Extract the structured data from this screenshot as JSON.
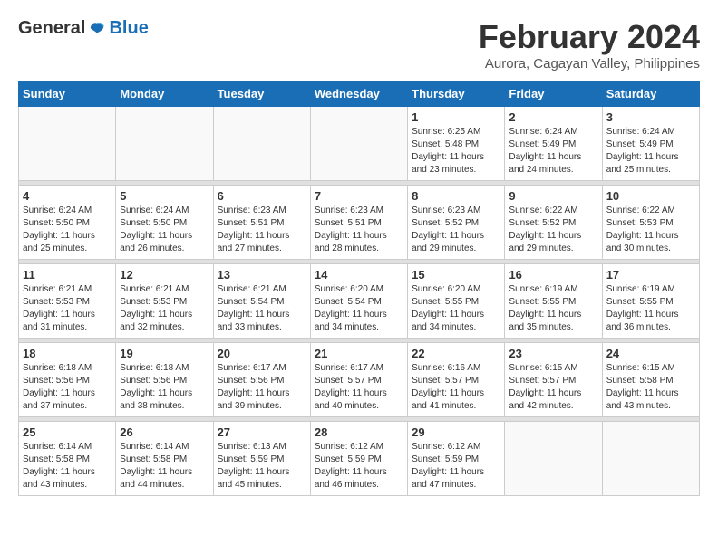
{
  "header": {
    "logo_general": "General",
    "logo_blue": "Blue",
    "title": "February 2024",
    "subtitle": "Aurora, Cagayan Valley, Philippines"
  },
  "weekdays": [
    "Sunday",
    "Monday",
    "Tuesday",
    "Wednesday",
    "Thursday",
    "Friday",
    "Saturday"
  ],
  "weeks": [
    [
      {
        "day": "",
        "sunrise": "",
        "sunset": "",
        "daylight": ""
      },
      {
        "day": "",
        "sunrise": "",
        "sunset": "",
        "daylight": ""
      },
      {
        "day": "",
        "sunrise": "",
        "sunset": "",
        "daylight": ""
      },
      {
        "day": "",
        "sunrise": "",
        "sunset": "",
        "daylight": ""
      },
      {
        "day": "1",
        "sunrise": "Sunrise: 6:25 AM",
        "sunset": "Sunset: 5:48 PM",
        "daylight": "Daylight: 11 hours and 23 minutes."
      },
      {
        "day": "2",
        "sunrise": "Sunrise: 6:24 AM",
        "sunset": "Sunset: 5:49 PM",
        "daylight": "Daylight: 11 hours and 24 minutes."
      },
      {
        "day": "3",
        "sunrise": "Sunrise: 6:24 AM",
        "sunset": "Sunset: 5:49 PM",
        "daylight": "Daylight: 11 hours and 25 minutes."
      }
    ],
    [
      {
        "day": "4",
        "sunrise": "Sunrise: 6:24 AM",
        "sunset": "Sunset: 5:50 PM",
        "daylight": "Daylight: 11 hours and 25 minutes."
      },
      {
        "day": "5",
        "sunrise": "Sunrise: 6:24 AM",
        "sunset": "Sunset: 5:50 PM",
        "daylight": "Daylight: 11 hours and 26 minutes."
      },
      {
        "day": "6",
        "sunrise": "Sunrise: 6:23 AM",
        "sunset": "Sunset: 5:51 PM",
        "daylight": "Daylight: 11 hours and 27 minutes."
      },
      {
        "day": "7",
        "sunrise": "Sunrise: 6:23 AM",
        "sunset": "Sunset: 5:51 PM",
        "daylight": "Daylight: 11 hours and 28 minutes."
      },
      {
        "day": "8",
        "sunrise": "Sunrise: 6:23 AM",
        "sunset": "Sunset: 5:52 PM",
        "daylight": "Daylight: 11 hours and 29 minutes."
      },
      {
        "day": "9",
        "sunrise": "Sunrise: 6:22 AM",
        "sunset": "Sunset: 5:52 PM",
        "daylight": "Daylight: 11 hours and 29 minutes."
      },
      {
        "day": "10",
        "sunrise": "Sunrise: 6:22 AM",
        "sunset": "Sunset: 5:53 PM",
        "daylight": "Daylight: 11 hours and 30 minutes."
      }
    ],
    [
      {
        "day": "11",
        "sunrise": "Sunrise: 6:21 AM",
        "sunset": "Sunset: 5:53 PM",
        "daylight": "Daylight: 11 hours and 31 minutes."
      },
      {
        "day": "12",
        "sunrise": "Sunrise: 6:21 AM",
        "sunset": "Sunset: 5:53 PM",
        "daylight": "Daylight: 11 hours and 32 minutes."
      },
      {
        "day": "13",
        "sunrise": "Sunrise: 6:21 AM",
        "sunset": "Sunset: 5:54 PM",
        "daylight": "Daylight: 11 hours and 33 minutes."
      },
      {
        "day": "14",
        "sunrise": "Sunrise: 6:20 AM",
        "sunset": "Sunset: 5:54 PM",
        "daylight": "Daylight: 11 hours and 34 minutes."
      },
      {
        "day": "15",
        "sunrise": "Sunrise: 6:20 AM",
        "sunset": "Sunset: 5:55 PM",
        "daylight": "Daylight: 11 hours and 34 minutes."
      },
      {
        "day": "16",
        "sunrise": "Sunrise: 6:19 AM",
        "sunset": "Sunset: 5:55 PM",
        "daylight": "Daylight: 11 hours and 35 minutes."
      },
      {
        "day": "17",
        "sunrise": "Sunrise: 6:19 AM",
        "sunset": "Sunset: 5:55 PM",
        "daylight": "Daylight: 11 hours and 36 minutes."
      }
    ],
    [
      {
        "day": "18",
        "sunrise": "Sunrise: 6:18 AM",
        "sunset": "Sunset: 5:56 PM",
        "daylight": "Daylight: 11 hours and 37 minutes."
      },
      {
        "day": "19",
        "sunrise": "Sunrise: 6:18 AM",
        "sunset": "Sunset: 5:56 PM",
        "daylight": "Daylight: 11 hours and 38 minutes."
      },
      {
        "day": "20",
        "sunrise": "Sunrise: 6:17 AM",
        "sunset": "Sunset: 5:56 PM",
        "daylight": "Daylight: 11 hours and 39 minutes."
      },
      {
        "day": "21",
        "sunrise": "Sunrise: 6:17 AM",
        "sunset": "Sunset: 5:57 PM",
        "daylight": "Daylight: 11 hours and 40 minutes."
      },
      {
        "day": "22",
        "sunrise": "Sunrise: 6:16 AM",
        "sunset": "Sunset: 5:57 PM",
        "daylight": "Daylight: 11 hours and 41 minutes."
      },
      {
        "day": "23",
        "sunrise": "Sunrise: 6:15 AM",
        "sunset": "Sunset: 5:57 PM",
        "daylight": "Daylight: 11 hours and 42 minutes."
      },
      {
        "day": "24",
        "sunrise": "Sunrise: 6:15 AM",
        "sunset": "Sunset: 5:58 PM",
        "daylight": "Daylight: 11 hours and 43 minutes."
      }
    ],
    [
      {
        "day": "25",
        "sunrise": "Sunrise: 6:14 AM",
        "sunset": "Sunset: 5:58 PM",
        "daylight": "Daylight: 11 hours and 43 minutes."
      },
      {
        "day": "26",
        "sunrise": "Sunrise: 6:14 AM",
        "sunset": "Sunset: 5:58 PM",
        "daylight": "Daylight: 11 hours and 44 minutes."
      },
      {
        "day": "27",
        "sunrise": "Sunrise: 6:13 AM",
        "sunset": "Sunset: 5:59 PM",
        "daylight": "Daylight: 11 hours and 45 minutes."
      },
      {
        "day": "28",
        "sunrise": "Sunrise: 6:12 AM",
        "sunset": "Sunset: 5:59 PM",
        "daylight": "Daylight: 11 hours and 46 minutes."
      },
      {
        "day": "29",
        "sunrise": "Sunrise: 6:12 AM",
        "sunset": "Sunset: 5:59 PM",
        "daylight": "Daylight: 11 hours and 47 minutes."
      },
      {
        "day": "",
        "sunrise": "",
        "sunset": "",
        "daylight": ""
      },
      {
        "day": "",
        "sunrise": "",
        "sunset": "",
        "daylight": ""
      }
    ]
  ]
}
